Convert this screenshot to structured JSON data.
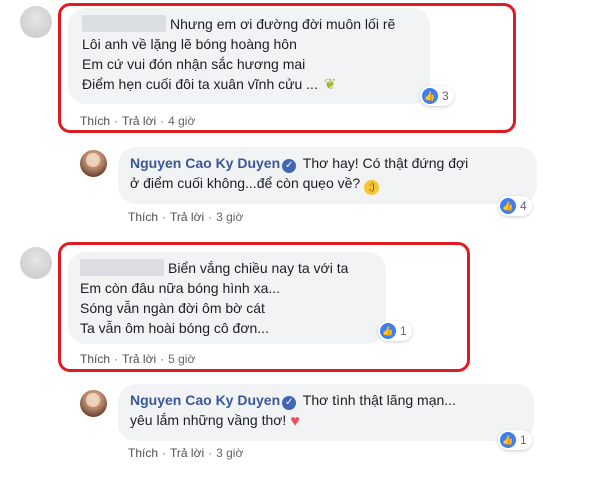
{
  "comments": [
    {
      "lines": [
        "Nhưng em ơi đường đời muôn lối rẽ",
        "Lôi anh về lặng lẽ bóng hoàng hôn",
        "Em cứ vui đón nhận sắc hương mai",
        "Điểm hẹn cuối đôi ta xuân vĩnh cửu ..."
      ],
      "likes": "3",
      "like_label": "Thích",
      "reply_label": "Trả lời",
      "time": "4 giờ"
    },
    {
      "author": "Nguyen Cao Ky Duyen",
      "lines": [
        "Thơ hay! Có thật đứng đợi",
        "ở điểm cuối không...để còn quẹo về?"
      ],
      "likes": "4",
      "like_label": "Thích",
      "reply_label": "Trả lời",
      "time": "3 giờ"
    },
    {
      "lines": [
        "Biển vắng chiều nay ta với ta",
        "Em còn đâu nữa bóng hình xa...",
        "Sóng vẫn ngàn đời ôm bờ cát",
        "Ta vẫn ôm hoài bóng cô đơn..."
      ],
      "likes": "1",
      "like_label": "Thích",
      "reply_label": "Trả lời",
      "time": "5 giờ"
    },
    {
      "author": "Nguyen Cao Ky Duyen",
      "lines": [
        "Thơ tình thật lãng mạn...",
        "yêu lắm những vầng thơ!"
      ],
      "likes": "1",
      "like_label": "Thích",
      "reply_label": "Trả lời",
      "time": "3 giờ"
    }
  ],
  "icons": {
    "verified": "verified-badge-icon",
    "like": "thumbs-up-icon",
    "wink": "wink-emoji-icon",
    "heart": "heart-emoji-icon",
    "plant": "plant-emoji-icon"
  },
  "colors": {
    "bubble": "#f2f3f5",
    "author": "#385898",
    "like": "#3d7ef0",
    "highlight": "#e01b24",
    "heart": "#f04a5f"
  }
}
